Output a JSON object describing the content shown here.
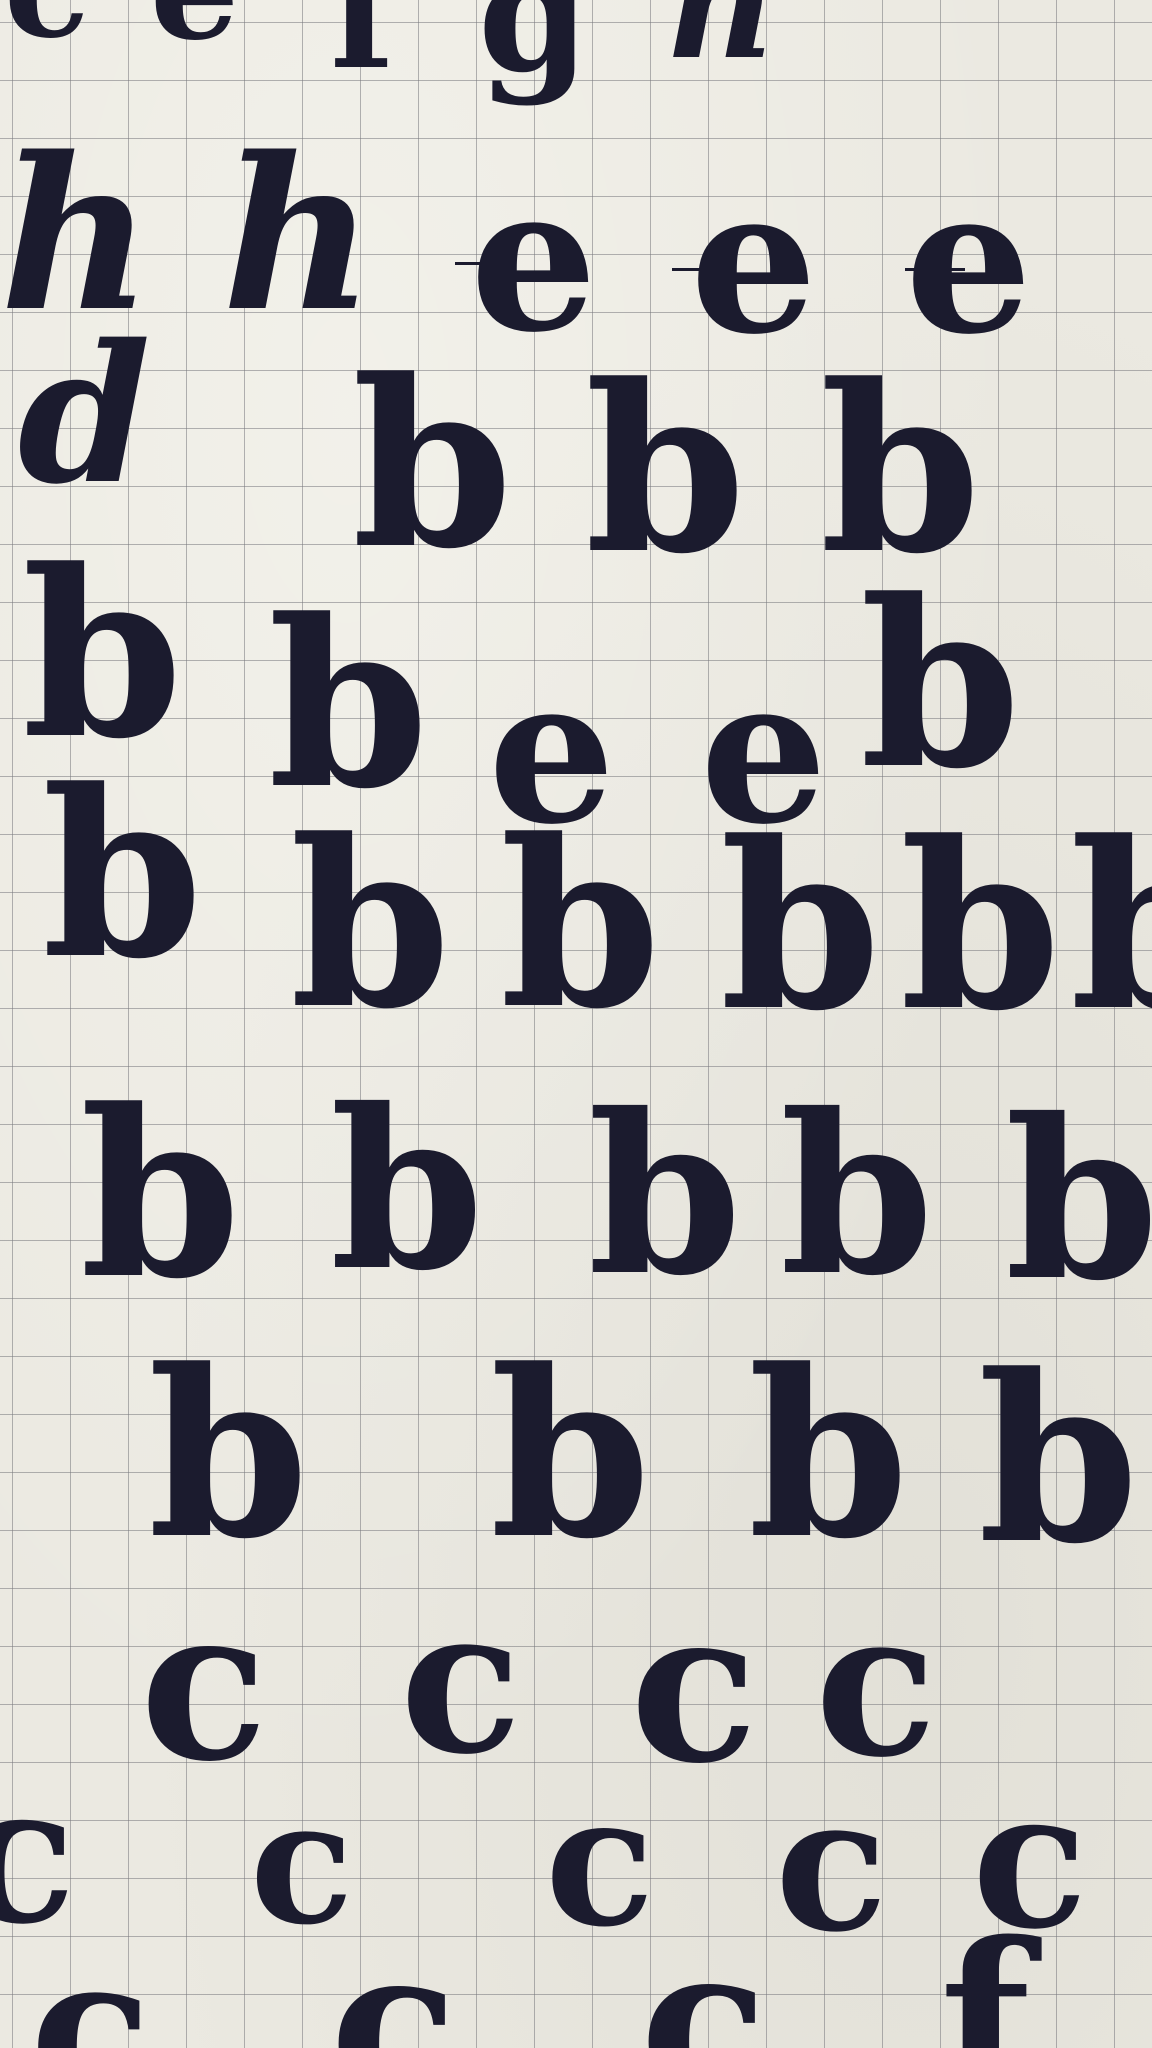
{
  "photo": {
    "subject": "calligraphy practice sheet",
    "paper_color": "#ebe9e1",
    "grid_color": "#7a7a80",
    "ink_color": "#1b1b2e",
    "glyphs": [
      {
        "text": "c",
        "row": 1
      },
      {
        "text": "e",
        "row": 1
      },
      {
        "text": "f",
        "row": 1
      },
      {
        "text": "g",
        "row": 1
      },
      {
        "text": "h",
        "row": 1
      },
      {
        "text": "h",
        "row": 2
      },
      {
        "text": "h",
        "row": 2
      },
      {
        "text": "e",
        "row": 2
      },
      {
        "text": "e",
        "row": 2
      },
      {
        "text": "e",
        "row": 2
      },
      {
        "text": "d",
        "row": 3
      },
      {
        "text": "b",
        "row": 3
      },
      {
        "text": "b",
        "row": 3
      },
      {
        "text": "b",
        "row": 3
      },
      {
        "text": "b",
        "row": 4
      },
      {
        "text": "b",
        "row": 4
      },
      {
        "text": "e",
        "row": 4
      },
      {
        "text": "e",
        "row": 4
      },
      {
        "text": "b",
        "row": 4
      },
      {
        "text": "b",
        "row": 5
      },
      {
        "text": "b",
        "row": 5
      },
      {
        "text": "b",
        "row": 5
      },
      {
        "text": "b",
        "row": 5
      },
      {
        "text": "b",
        "row": 5
      },
      {
        "text": "b",
        "row": 5
      },
      {
        "text": "b",
        "row": 6
      },
      {
        "text": "b",
        "row": 6
      },
      {
        "text": "b",
        "row": 6
      },
      {
        "text": "b",
        "row": 6
      },
      {
        "text": "b",
        "row": 6
      },
      {
        "text": "b",
        "row": 7
      },
      {
        "text": "b",
        "row": 7
      },
      {
        "text": "b",
        "row": 7
      },
      {
        "text": "b",
        "row": 7
      },
      {
        "text": "c",
        "row": 8
      },
      {
        "text": "c",
        "row": 8
      },
      {
        "text": "c",
        "row": 8
      },
      {
        "text": "c",
        "row": 8
      },
      {
        "text": "c",
        "row": 9
      },
      {
        "text": "c",
        "row": 9
      },
      {
        "text": "c",
        "row": 9
      },
      {
        "text": "c",
        "row": 9
      },
      {
        "text": "c",
        "row": 9
      },
      {
        "text": "c",
        "row": 10
      },
      {
        "text": "c",
        "row": 10
      },
      {
        "text": "c",
        "row": 10
      },
      {
        "text": "f",
        "row": 10
      }
    ]
  }
}
